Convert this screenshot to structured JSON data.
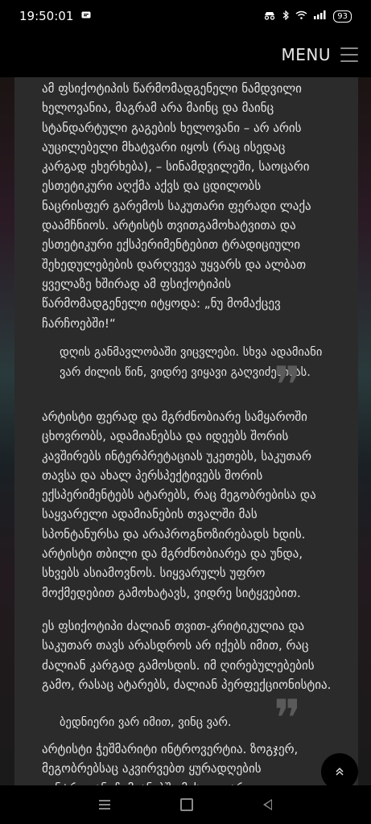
{
  "status": {
    "time": "19:50:01",
    "battery": "93"
  },
  "header": {
    "menu_label": "MENU"
  },
  "content": {
    "paragraph1": "ამ ფსიქოტიპის წარმომადგენელი ნამდვილი ხელოვანია, მაგრამ არა მაინც და მაინც სტანდარტული გაგების ხელოვანი – არ არის აუცილებელი მხატვარი იყოს (რაც ისედაც კარგად ეხერხება), – სინამდვილეში, საოცარი ესთეტიკური აღქმა აქვს და ცდილობს ნაცრისფერ გარემოს საკუთარი ფერადი ლაქა დაამჩნიოს. არტისტს თვითგამოხატვითა და ესთეტიკური ექსპერიმენტებით ტრადიციული შეხედულებების დარღვევა უყვარს და ალბათ ყველაზე ხშირად ამ ფსიქოტიპის წარმომადგენელი იტყოდა: „ნუ მომაქცევ ჩარჩოებში!“",
    "quote1": "დღის განმავლობაში ვიცვლები. სხვა ადამიანი ვარ ძილის წინ, ვიდრე ვიყავი გაღვიძებისას.",
    "paragraph2": "არტისტი ფერად და მგრძნობიარე სამყაროში ცხოვრობს, ადამიანებსა და იდეებს შორის კავშირებს ინტერპრეტაციას უკეთებს, საკუთარ თავსა და ახალ პერსპექტივებს შორის ექსპერიმენტებს ატარებს, რაც მეგობრებისა და საყვარელი ადამიანების თვალში მას სპონტანურსა და არაპროგნოზირებადს ხდის. არტისტი თბილი და მგრძნობიარეა და უნდა, სხვებს ასიამოვნოს. სიყვარულს უფრო მოქმედებით გამოხატავს, ვიდრე სიტყვებით.",
    "paragraph3": "ეს ფსიქოტიპი ძალიან თვით-კრიტიკულია და საკუთარ თავს არასდროს არ იქებს იმით, რაც ძალიან კარგად გამოსდის. იმ ღირებულებების გამო, რასაც ატარებს, ძალიან პერფექციონისტია.",
    "quote2": "ბედნიერი ვარ იმით, ვინც ვარ.",
    "paragraph4": "არტისტი ჭეშმარიტი ინტროვერტია. ზოგჯერ, მეგობრებსაც აკვირვებთ ყურადღების ცენტრიდან, ჩუმიანებში მისი უეცარი",
    "quote_mark": "❞"
  },
  "scroll_top_icon": "double-chevron-up-icon",
  "nav": {
    "menu_icon": "recent-apps-icon",
    "home_icon": "home-icon",
    "back_icon": "back-icon"
  }
}
